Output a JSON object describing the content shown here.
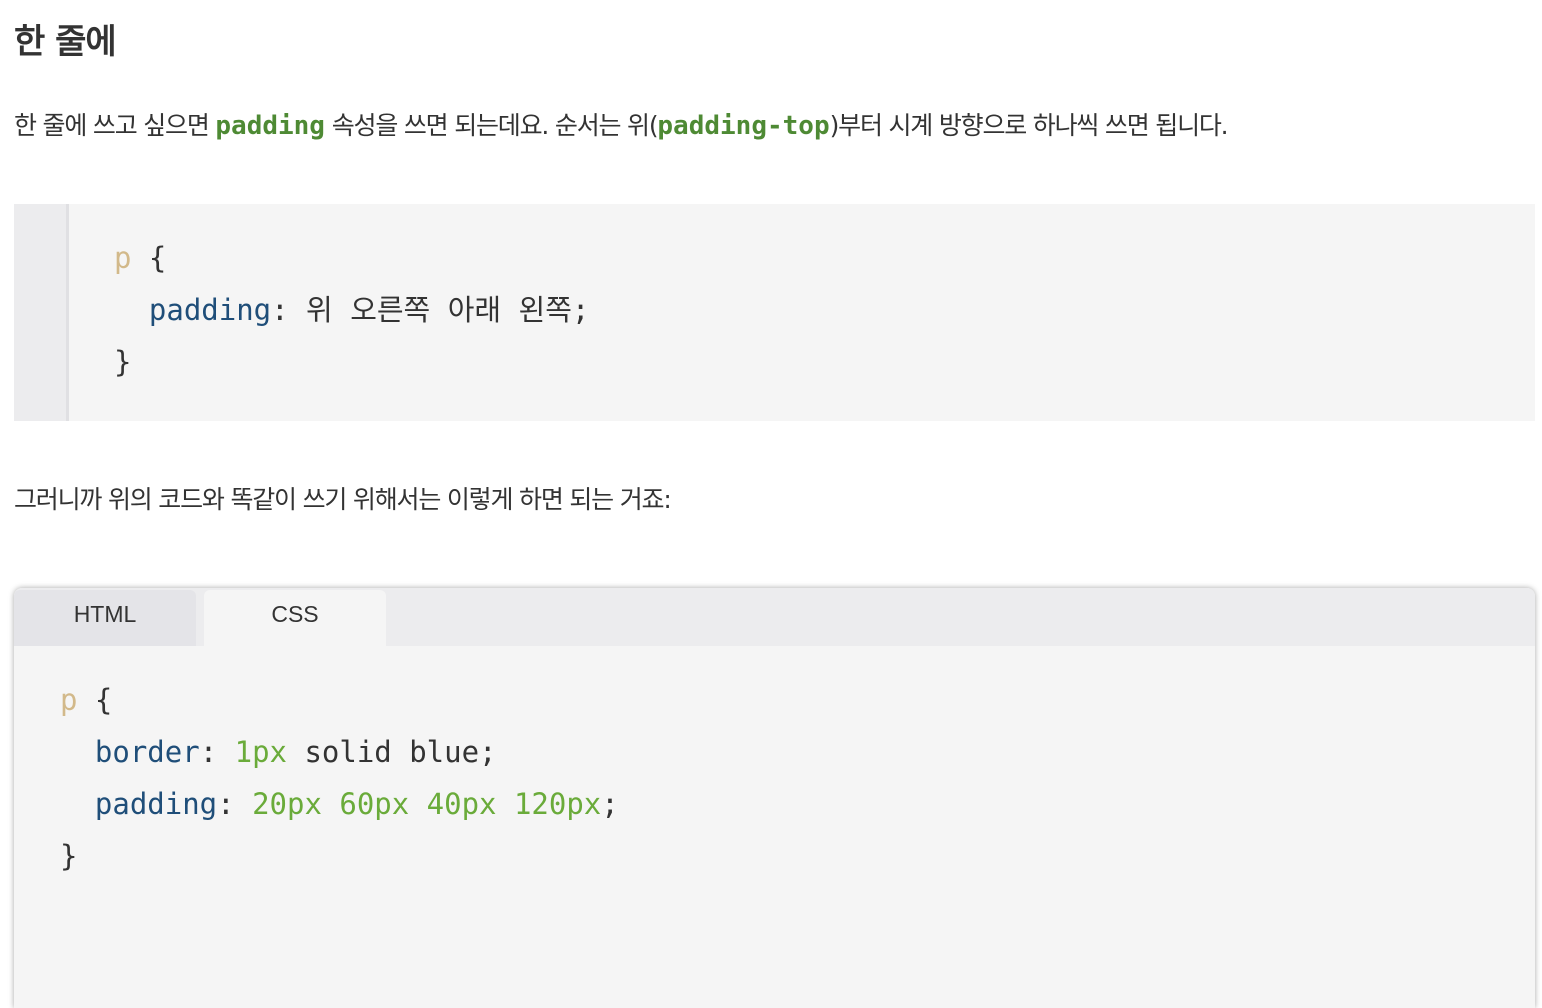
{
  "heading": "한 줄에",
  "para1": {
    "before": "한 줄에 쓰고 싶으면 ",
    "code1": "padding",
    "middle": " 속성을 쓰면 되는데요. 순서는 위(",
    "code2": "padding-top",
    "after": ")부터 시계 방향으로 하나씩 쓰면 됩니다."
  },
  "code1": {
    "selector": "p",
    "open": " {",
    "property": "padding",
    "value": ": 위 오른쪽 아래 왼쪽;",
    "close": "}"
  },
  "para2": "그러니까 위의 코드와 똑같이 쓰기 위해서는 이렇게 하면 되는 거죠:",
  "tabs": [
    {
      "label": "HTML"
    },
    {
      "label": "CSS",
      "active": true
    }
  ],
  "code2": {
    "selector": "p",
    "open": " {",
    "line1": {
      "property": "border",
      "colon": ": ",
      "num": "1px",
      "rest": " solid blue;"
    },
    "line2": {
      "property": "padding",
      "colon": ": ",
      "nums": "20px 60px 40px 120px",
      "semi": ";"
    },
    "close": "}"
  },
  "colors": {
    "inline_code": "#4e8a34",
    "selector": "#d2b98a",
    "property": "#1f4e79",
    "number": "#6aab3a"
  }
}
